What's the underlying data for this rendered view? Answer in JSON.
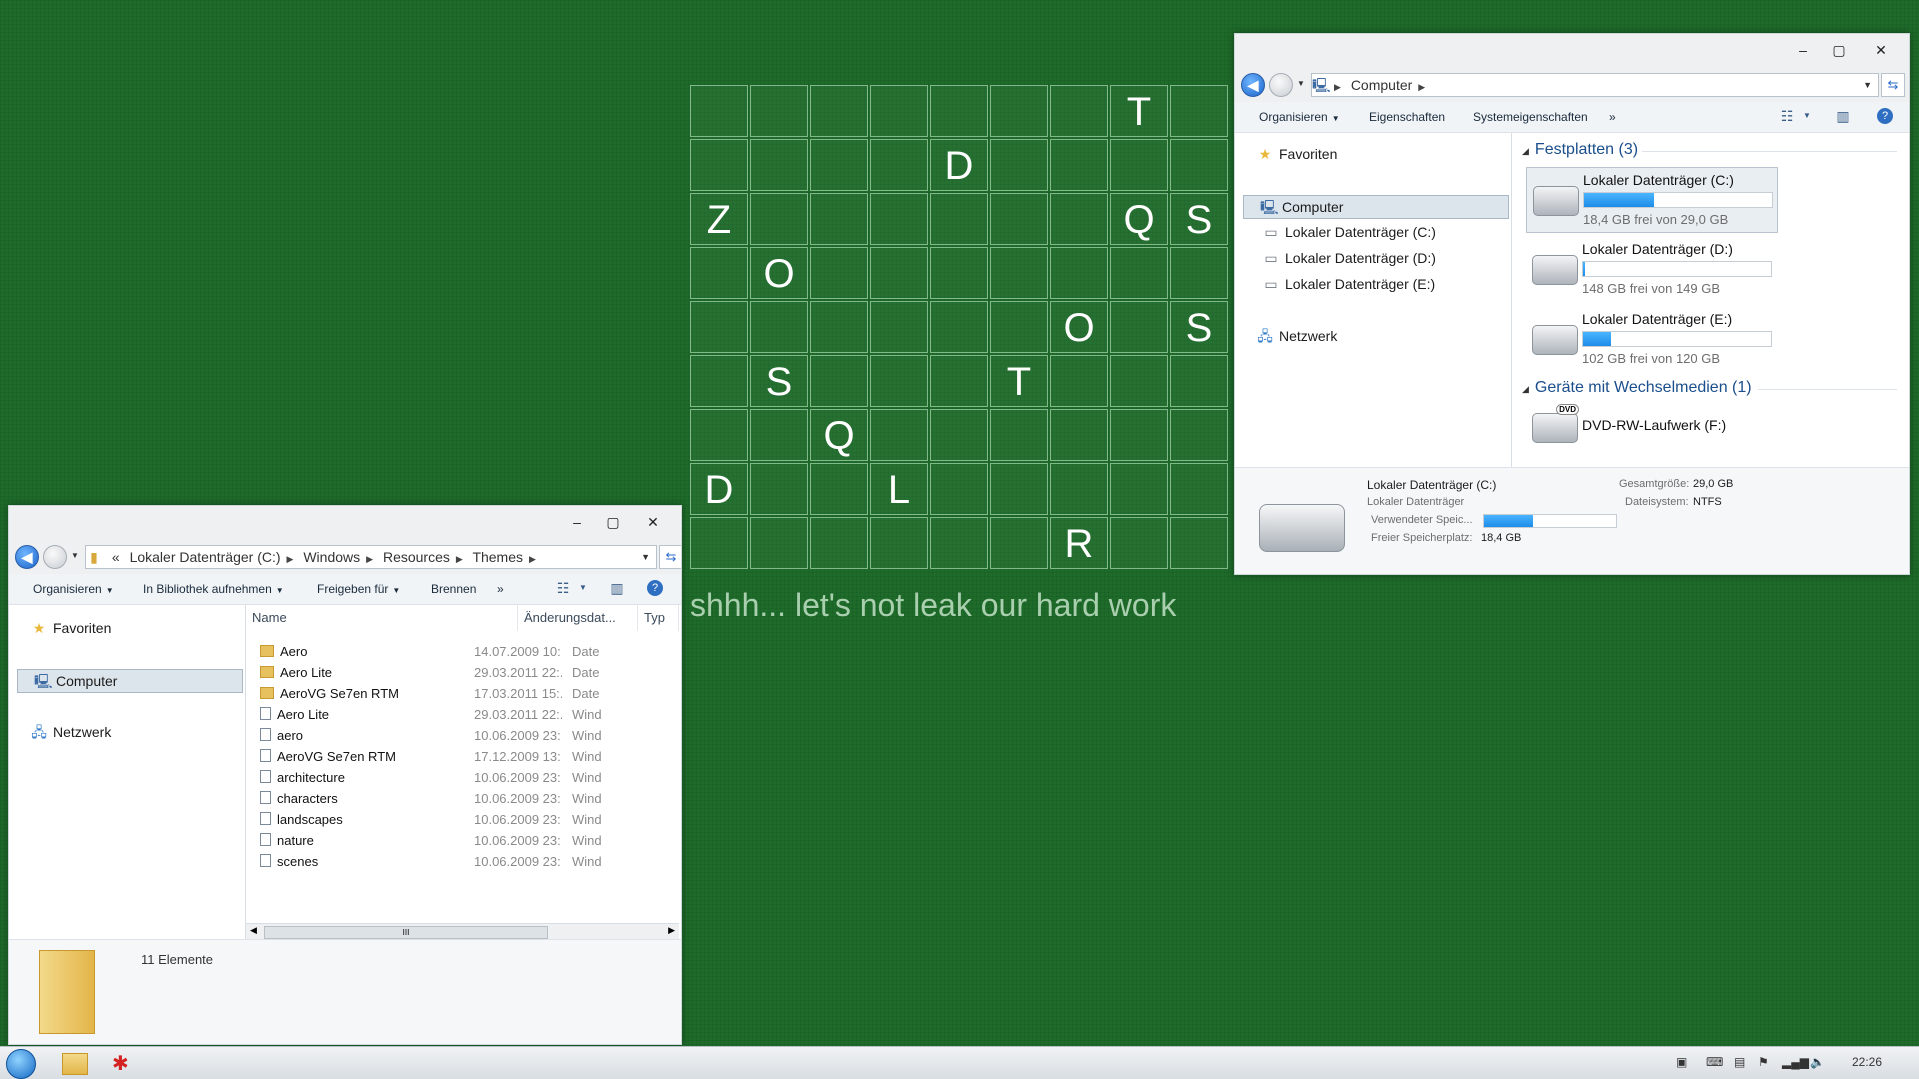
{
  "desktop": {
    "grid_letters": [
      {
        "row": 0,
        "col": 7,
        "ch": "T"
      },
      {
        "row": 1,
        "col": 4,
        "ch": "D"
      },
      {
        "row": 2,
        "col": 0,
        "ch": "Z"
      },
      {
        "row": 2,
        "col": 7,
        "ch": "Q"
      },
      {
        "row": 2,
        "col": 8,
        "ch": "S"
      },
      {
        "row": 3,
        "col": 1,
        "ch": "O"
      },
      {
        "row": 4,
        "col": 6,
        "ch": "O"
      },
      {
        "row": 4,
        "col": 8,
        "ch": "S"
      },
      {
        "row": 5,
        "col": 1,
        "ch": "S"
      },
      {
        "row": 5,
        "col": 5,
        "ch": "T"
      },
      {
        "row": 6,
        "col": 2,
        "ch": "Q"
      },
      {
        "row": 7,
        "col": 0,
        "ch": "D"
      },
      {
        "row": 7,
        "col": 3,
        "ch": "L"
      },
      {
        "row": 8,
        "col": 6,
        "ch": "R"
      }
    ],
    "tagline": "shhh... let's not leak our hard work"
  },
  "themes_window": {
    "breadcrumb": [
      "«",
      "Lokaler Datenträger (C:)",
      "Windows",
      "Resources",
      "Themes"
    ],
    "toolbar": {
      "organize": "Organisieren",
      "library": "In Bibliothek aufnehmen",
      "share": "Freigeben für",
      "burn": "Brennen",
      "more": "»"
    },
    "nav": {
      "favorites": "Favoriten",
      "computer": "Computer",
      "network": "Netzwerk"
    },
    "columns": {
      "name": "Name",
      "date": "Änderungsdat...",
      "type": "Typ"
    },
    "files": [
      {
        "name": "Aero",
        "date": "14.07.2009 10:...",
        "type": "Date",
        "kind": "folder"
      },
      {
        "name": "Aero Lite",
        "date": "29.03.2011 22:...",
        "type": "Date",
        "kind": "folder"
      },
      {
        "name": "AeroVG Se7en RTM",
        "date": "17.03.2011 15:...",
        "type": "Date",
        "kind": "folder"
      },
      {
        "name": "Aero Lite",
        "date": "29.03.2011 22:...",
        "type": "Wind",
        "kind": "theme"
      },
      {
        "name": "aero",
        "date": "10.06.2009 23:...",
        "type": "Wind",
        "kind": "theme"
      },
      {
        "name": "AeroVG Se7en RTM",
        "date": "17.12.2009 13:...",
        "type": "Wind",
        "kind": "theme"
      },
      {
        "name": "architecture",
        "date": "10.06.2009 23:...",
        "type": "Wind",
        "kind": "theme"
      },
      {
        "name": "characters",
        "date": "10.06.2009 23:...",
        "type": "Wind",
        "kind": "theme"
      },
      {
        "name": "landscapes",
        "date": "10.06.2009 23:...",
        "type": "Wind",
        "kind": "theme"
      },
      {
        "name": "nature",
        "date": "10.06.2009 23:...",
        "type": "Wind",
        "kind": "theme"
      },
      {
        "name": "scenes",
        "date": "10.06.2009 23:...",
        "type": "Wind",
        "kind": "theme"
      }
    ],
    "status": "11 Elemente",
    "scroll_grip": "III"
  },
  "computer_window": {
    "breadcrumb": [
      "Computer"
    ],
    "toolbar": {
      "organize": "Organisieren",
      "properties": "Eigenschaften",
      "system_properties": "Systemeigenschaften",
      "more": "»"
    },
    "nav": {
      "favorites": "Favoriten",
      "computer": "Computer",
      "drive_c": "Lokaler Datenträger (C:)",
      "drive_d": "Lokaler Datenträger (D:)",
      "drive_e": "Lokaler Datenträger (E:)",
      "network": "Netzwerk"
    },
    "hard_disks_header": "Festplatten (3)",
    "drives": [
      {
        "name": "Lokaler Datenträger (C:)",
        "free": "18,4 GB frei von 29,0 GB",
        "used_fraction": 0.37
      },
      {
        "name": "Lokaler Datenträger (D:)",
        "free": "148 GB frei von 149 GB",
        "used_fraction": 0.01
      },
      {
        "name": "Lokaler Datenträger (E:)",
        "free": "102 GB frei von 120 GB",
        "used_fraction": 0.15
      }
    ],
    "removable_header": "Geräte mit Wechselmedien (1)",
    "dvd": {
      "name": "DVD-RW-Laufwerk (F:)",
      "badge": "DVD"
    },
    "details": {
      "title": "Lokaler Datenträger (C:)",
      "subtitle": "Lokaler Datenträger",
      "used_label": "Verwendeter Speic...",
      "used_fraction": 0.37,
      "free_label": "Freier Speicherplatz:",
      "free_value": "18,4 GB",
      "total_label": "Gesamtgröße:",
      "total_value": "29,0 GB",
      "fs_label": "Dateisystem:",
      "fs_value": "NTFS"
    }
  },
  "taskbar": {
    "clock": "22:26"
  }
}
